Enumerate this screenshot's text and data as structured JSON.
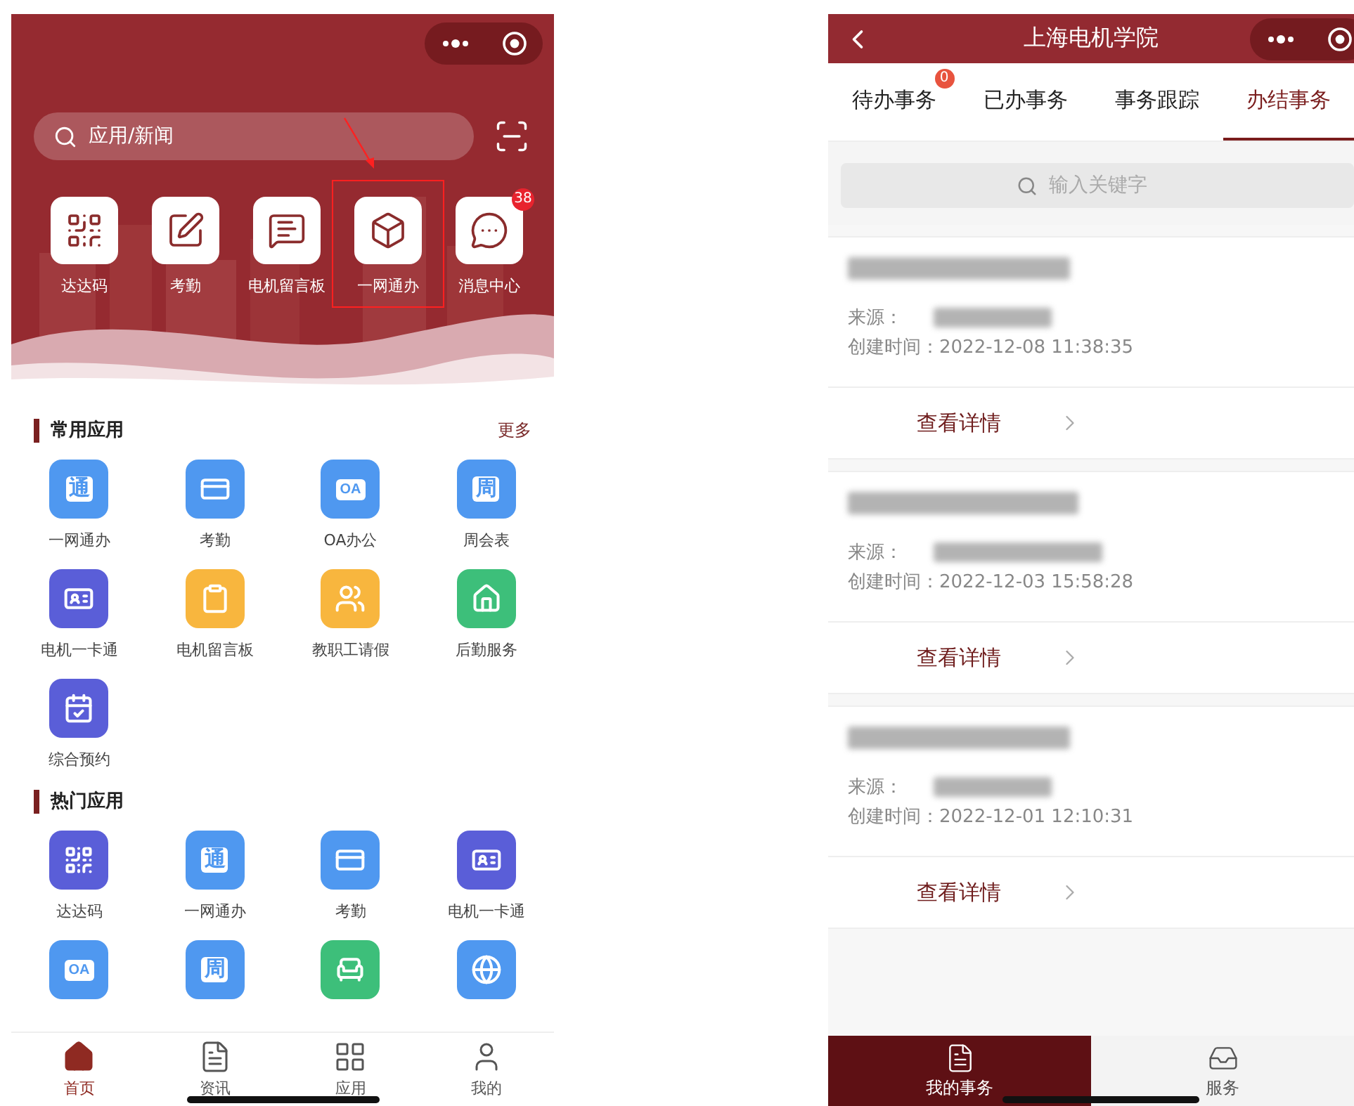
{
  "home": {
    "search": {
      "placeholder": "应用/新闻"
    },
    "quick_apps": [
      {
        "label": "达达码",
        "kind": "qr",
        "highlighted": false
      },
      {
        "label": "考勤",
        "kind": "pen",
        "highlighted": false
      },
      {
        "label": "电机留言板",
        "kind": "board",
        "highlighted": false
      },
      {
        "label": "一网通办",
        "kind": "box",
        "highlighted": true
      },
      {
        "label": "消息中心",
        "kind": "chat",
        "highlighted": false,
        "badge": "38"
      }
    ],
    "sections": [
      {
        "title": "常用应用",
        "more": "更多",
        "apps": [
          {
            "label": "一网通办",
            "kind": "glyph",
            "glyph": "通",
            "color": "#4f98f0"
          },
          {
            "label": "考勤",
            "kind": "card",
            "color": "#4f98f0"
          },
          {
            "label": "OA办公",
            "kind": "glyph",
            "glyph": "OA",
            "color": "#4f98f0"
          },
          {
            "label": "周会表",
            "kind": "glyph",
            "glyph": "周",
            "color": "#4f98f0"
          },
          {
            "label": "电机一卡通",
            "kind": "idcard",
            "color": "#5a5ed8"
          },
          {
            "label": "电机留言板",
            "kind": "clipboard",
            "color": "#f8b63e"
          },
          {
            "label": "教职工请假",
            "kind": "leave",
            "color": "#f8b63e"
          },
          {
            "label": "后勤服务",
            "kind": "house",
            "color": "#3dbf7a"
          },
          {
            "label": "综合预约",
            "kind": "calendar",
            "color": "#5a5ed8"
          }
        ]
      },
      {
        "title": "热门应用",
        "apps": [
          {
            "label": "达达码",
            "kind": "qr",
            "color": "#5a5ed8"
          },
          {
            "label": "一网通办",
            "kind": "glyph",
            "glyph": "通",
            "color": "#4f98f0"
          },
          {
            "label": "考勤",
            "kind": "card",
            "color": "#4f98f0"
          },
          {
            "label": "电机一卡通",
            "kind": "idcard",
            "color": "#5a5ed8"
          },
          {
            "kind": "glyph",
            "glyph": "OA",
            "color": "#4f98f0"
          },
          {
            "kind": "glyph",
            "glyph": "周",
            "color": "#4f98f0"
          },
          {
            "kind": "sofa",
            "color": "#3dbf7a"
          },
          {
            "kind": "globe",
            "color": "#4f98f0"
          }
        ]
      }
    ],
    "tab_bar": [
      {
        "label": "首页",
        "kind": "home",
        "selected": true
      },
      {
        "label": "资讯",
        "kind": "news",
        "selected": false
      },
      {
        "label": "应用",
        "kind": "grid",
        "selected": false
      },
      {
        "label": "我的",
        "kind": "user",
        "selected": false
      }
    ]
  },
  "affairs": {
    "title": "上海电机学院",
    "tabs": [
      {
        "label": "待办事务",
        "badge": "0",
        "selected": false
      },
      {
        "label": "已办事务",
        "selected": false
      },
      {
        "label": "事务跟踪",
        "selected": false
      },
      {
        "label": "办结事务",
        "selected": true
      }
    ],
    "search": {
      "placeholder": "输入关键字"
    },
    "records": [
      {
        "source_label": "来源：",
        "created": "创建时间：2022-12-08 11:38:35",
        "action": "查看详情"
      },
      {
        "source_label": "来源：",
        "created": "创建时间：2022-12-03 15:58:28",
        "action": "查看详情"
      },
      {
        "source_label": "来源：",
        "created": "创建时间：2022-12-01 12:10:31",
        "action": "查看详情"
      }
    ],
    "bottom_tabs": [
      {
        "label": "我的事务",
        "kind": "doc",
        "selected": true
      },
      {
        "label": "服务",
        "kind": "inbox",
        "selected": false
      }
    ]
  }
}
